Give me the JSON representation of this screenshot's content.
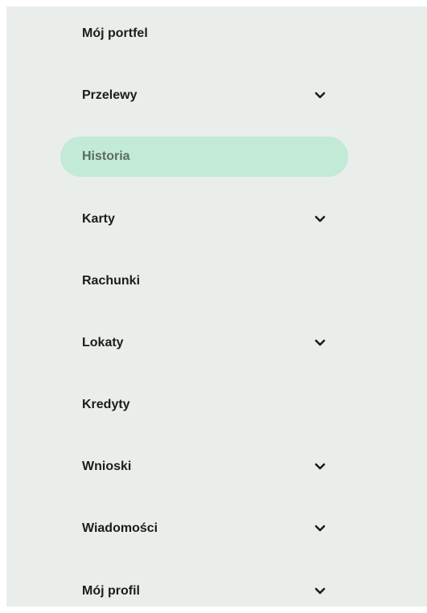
{
  "sidebar": {
    "items": [
      {
        "label": "Mój portfel",
        "has_chevron": false,
        "active": false
      },
      {
        "label": "Przelewy",
        "has_chevron": true,
        "active": false
      },
      {
        "label": "Historia",
        "has_chevron": false,
        "active": true
      },
      {
        "label": "Karty",
        "has_chevron": true,
        "active": false
      },
      {
        "label": "Rachunki",
        "has_chevron": false,
        "active": false
      },
      {
        "label": "Lokaty",
        "has_chevron": true,
        "active": false
      },
      {
        "label": "Kredyty",
        "has_chevron": false,
        "active": false
      },
      {
        "label": "Wnioski",
        "has_chevron": true,
        "active": false
      },
      {
        "label": "Wiadomości",
        "has_chevron": true,
        "active": false
      },
      {
        "label": "Mój profil",
        "has_chevron": true,
        "active": false
      }
    ],
    "icon": "chevron-down-icon",
    "colors": {
      "background": "#eaeeea",
      "active_background": "#c2ead7",
      "active_text": "#5a6b64",
      "text": "#1c1c1c"
    }
  }
}
